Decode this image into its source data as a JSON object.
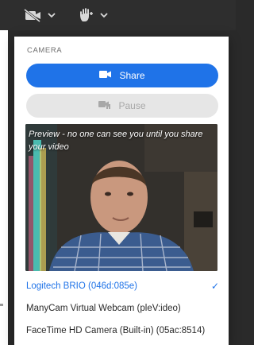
{
  "toolbar": {
    "camera_icon": "camera-off-icon",
    "hand_icon": "raise-hand-icon",
    "chevron_icon": "chevron-down-icon"
  },
  "camera_menu": {
    "section_label": "CAMERA",
    "share_label": "Share",
    "pause_label": "Pause",
    "preview_caption": "Preview - no one can see you until you share your video",
    "devices": [
      {
        "label": "Logitech BRIO (046d:085e)",
        "selected": true
      },
      {
        "label": "ManyCam Virtual Webcam (pleV:ideo)",
        "selected": false
      },
      {
        "label": "FaceTime HD Camera (Built-in) (05ac:8514)",
        "selected": false
      }
    ]
  },
  "colors": {
    "accent": "#1f73e8",
    "toolbar_bg": "#2e2e2e",
    "disabled_bg": "#e6e6e6"
  }
}
